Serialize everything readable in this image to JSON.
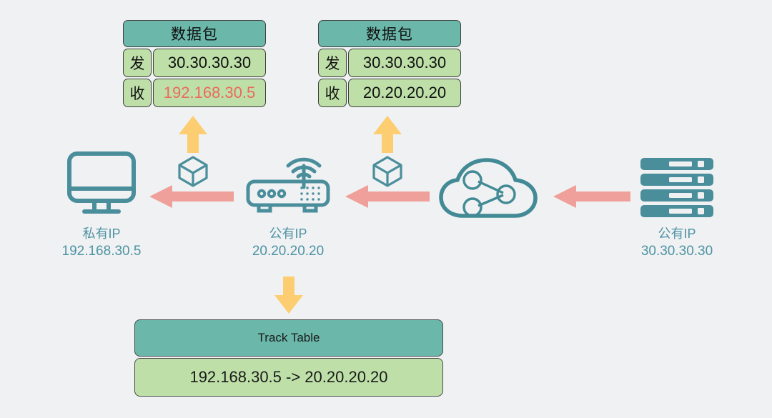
{
  "diagram": {
    "title": "NAT packet flow diagram",
    "background_color": "#f0f1f3",
    "colors": {
      "header_teal": "#6bb8ab",
      "cell_green": "#bee0a8",
      "icon_teal": "#4a8e9c",
      "arrow_pink": "#f0a09a",
      "arrow_yellow": "#fcce71",
      "label_blue": "#4d93a3",
      "highlight_red": "#ea6a5e"
    }
  },
  "packets": [
    {
      "id": "packet-left",
      "title": "数据包",
      "rows": [
        {
          "key": "发",
          "value": "30.30.30.30",
          "highlight": false
        },
        {
          "key": "收",
          "value": "192.168.30.5",
          "highlight": true
        }
      ]
    },
    {
      "id": "packet-right",
      "title": "数据包",
      "rows": [
        {
          "key": "发",
          "value": "30.30.30.30",
          "highlight": false
        },
        {
          "key": "收",
          "value": "20.20.20.20",
          "highlight": false
        }
      ]
    }
  ],
  "nodes": [
    {
      "id": "client",
      "icon": "monitor-icon",
      "kind": "私有IP",
      "address": "192.168.30.5"
    },
    {
      "id": "router",
      "icon": "router-icon",
      "kind": "公有IP",
      "address": "20.20.20.20"
    },
    {
      "id": "cloud",
      "icon": "cloud-network-icon",
      "kind": "",
      "address": ""
    },
    {
      "id": "server",
      "icon": "server-icon",
      "kind": "公有IP",
      "address": "30.30.30.30"
    }
  ],
  "track_table": {
    "title": "Track Table",
    "entry": "192.168.30.5 -> 20.20.20.20"
  },
  "arrows": [
    {
      "id": "arrow-cloud-to-router",
      "direction": "left",
      "color": "#f0a09a"
    },
    {
      "id": "arrow-server-to-cloud",
      "direction": "left",
      "color": "#f0a09a"
    },
    {
      "id": "arrow-router-to-client",
      "direction": "left",
      "color": "#f0a09a"
    },
    {
      "id": "arrow-packet-left-up",
      "direction": "up",
      "color": "#fcce71"
    },
    {
      "id": "arrow-packet-right-up",
      "direction": "up",
      "color": "#fcce71"
    },
    {
      "id": "arrow-router-to-track",
      "direction": "down",
      "color": "#fcce71"
    }
  ],
  "package_icons": [
    {
      "id": "package-left"
    },
    {
      "id": "package-right"
    }
  ]
}
